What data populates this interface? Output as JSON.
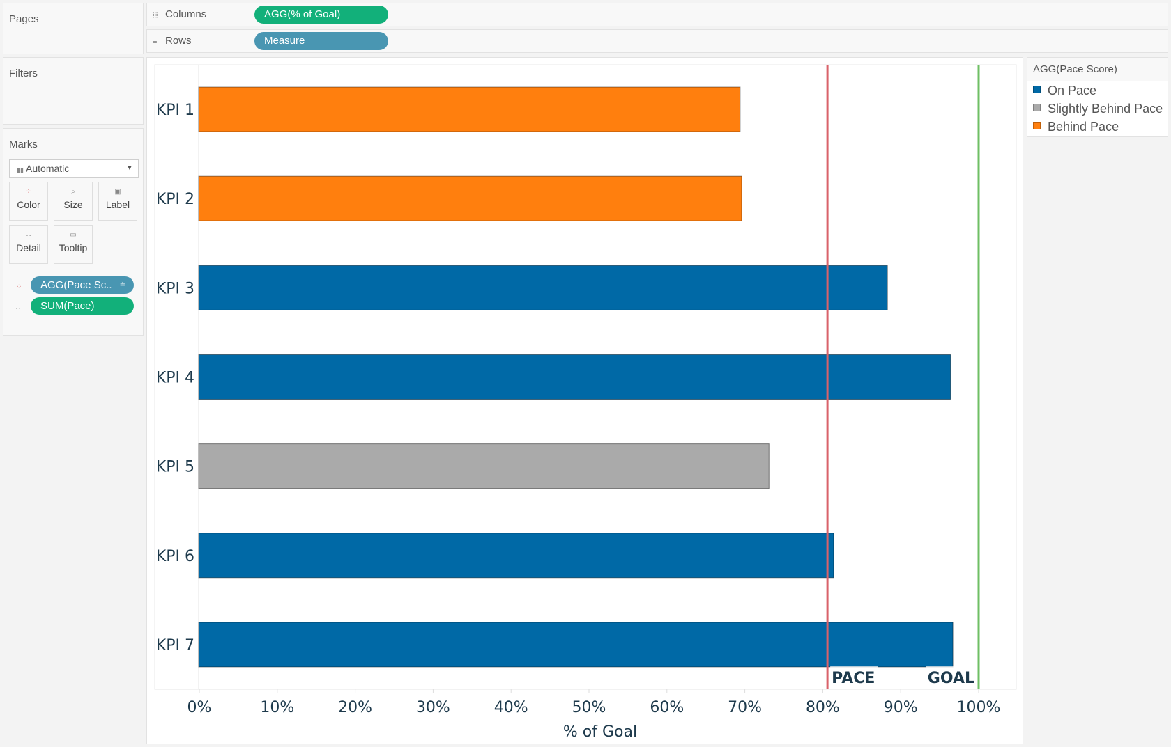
{
  "pages": {
    "title": "Pages"
  },
  "filters": {
    "title": "Filters"
  },
  "columns_shelf": {
    "label": "Columns",
    "icon": "columns-icon",
    "pill": "AGG(% of Goal)"
  },
  "rows_shelf": {
    "label": "Rows",
    "icon": "rows-icon",
    "pill": "Measure"
  },
  "marks": {
    "title": "Marks",
    "mark_type": "Automatic",
    "buttons": [
      {
        "label": "Color",
        "icon": "color-icon"
      },
      {
        "label": "Size",
        "icon": "size-icon"
      },
      {
        "label": "Label",
        "icon": "label-icon"
      },
      {
        "label": "Detail",
        "icon": "detail-icon"
      },
      {
        "label": "Tooltip",
        "icon": "tooltip-icon"
      }
    ],
    "pills": [
      {
        "label": "AGG(Pace Sc..",
        "icon": "color-icon",
        "color": "#4996b2"
      },
      {
        "label": "SUM(Pace)",
        "icon": "detail-icon",
        "color": "#12b07a"
      }
    ]
  },
  "legend": {
    "title": "AGG(Pace Score)",
    "items": [
      {
        "label": "On Pace",
        "color": "#0069a6"
      },
      {
        "label": "Slightly Behind Pace",
        "color": "#aaaaaa"
      },
      {
        "label": "Behind Pace",
        "color": "#ff7f0e"
      }
    ]
  },
  "chart_data": {
    "type": "bar",
    "orientation": "horizontal",
    "categories": [
      "KPI 1",
      "KPI 2",
      "KPI 3",
      "KPI 4",
      "KPI 5",
      "KPI 6",
      "KPI 7"
    ],
    "values": [
      0.694,
      0.696,
      0.883,
      0.964,
      0.731,
      0.814,
      0.967
    ],
    "status": [
      "Behind Pace",
      "Behind Pace",
      "On Pace",
      "On Pace",
      "Slightly Behind Pace",
      "On Pace",
      "On Pace"
    ],
    "status_colors": {
      "On Pace": "#0069a6",
      "Slightly Behind Pace": "#aaaaaa",
      "Behind Pace": "#ff7f0e"
    },
    "xlabel": "% of Goal",
    "ylabel": "",
    "xlim": [
      -0.015,
      1.03
    ],
    "xticks": [
      0,
      0.1,
      0.2,
      0.3,
      0.4,
      0.5,
      0.6,
      0.7,
      0.8,
      0.9,
      1.0
    ],
    "xtick_labels": [
      "0%",
      "10%",
      "20%",
      "30%",
      "40%",
      "50%",
      "60%",
      "70%",
      "80%",
      "90%",
      "100%"
    ],
    "reference_lines": [
      {
        "label": "PACE",
        "value": 0.806,
        "color": "#d9626a"
      },
      {
        "label": "GOAL",
        "value": 1.0,
        "color": "#6fbf64"
      }
    ],
    "grid": false,
    "legend_position": "right"
  }
}
